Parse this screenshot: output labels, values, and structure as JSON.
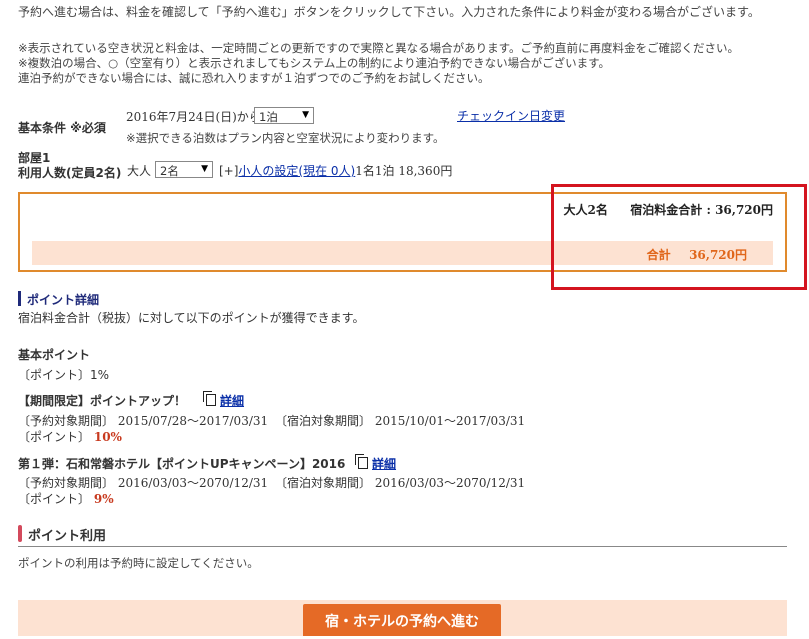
{
  "intro": {
    "line1": "予約へ進む場合は、料金を確認して「予約へ進む」ボタンをクリックして下さい。入力された条件により料金が変わる場合がございます。",
    "note1": "※表示されている空き状況と料金は、一定時間ごとの更新ですので実際と異なる場合があります。ご予約直前に再度料金をご確認ください。",
    "note2": "※複数泊の場合、○（空室有り）と表示されましてもシステム上の制約により連泊予約できない場合がございます。",
    "note3": "連泊予約ができない場合には、誠に恐れ入りますが１泊ずつでのご予約をお試しください。"
  },
  "conditions": {
    "label": "基本条件 ※必須",
    "checkin_date": "2016年7月24日(日)から",
    "nights_selected": "1泊",
    "change_checkin_link": "チェックイン日変更",
    "nights_note": "※選択できる泊数はプラン内容と空室状況により変わります。",
    "room_label": "部屋1",
    "guests_label": "利用人数(定員2名)",
    "adult_label": "大人",
    "adults_selected": "2名",
    "child_prefix": "[+]",
    "child_link": "小人の設定(現在 0人)",
    "per_person_price": "1名1泊 18,360円"
  },
  "price_summary": {
    "guests": "大人2名",
    "subtotal_label": "宿泊料金合計 : 36,720円",
    "total_label": "合計",
    "total_value": "36,720円"
  },
  "points": {
    "heading": "ポイント詳細",
    "description": "宿泊料金合計（税抜）に対して以下のポイントが獲得できます。",
    "basic": {
      "title": "基本ポイント",
      "rate": "〔ポイント〕1%"
    },
    "limited": {
      "title": "【期間限定】ポイントアップ！",
      "detail_link": "詳細",
      "reserve_period": "〔予約対象期間〕 2015/07/28〜2017/03/31",
      "stay_period": "〔宿泊対象期間〕 2015/10/01〜2017/03/31",
      "point_label": "〔ポイント〕",
      "point_value": "10%"
    },
    "campaign": {
      "title": "第１弾：石和常磐ホテル【ポイントUPキャンペーン】2016",
      "detail_link": "詳細",
      "reserve_period": "〔予約対象期間〕 2016/03/03〜2070/12/31",
      "stay_period": "〔宿泊対象期間〕 2016/03/03〜2070/12/31",
      "point_label": "〔ポイント〕",
      "point_value": "9%"
    }
  },
  "point_usage": {
    "heading": "ポイント利用",
    "note": "ポイントの利用は予約時に設定してください。"
  },
  "actions": {
    "proceed_button": "宿・ホテルの予約へ進む"
  },
  "colors": {
    "accent_orange": "#e56a26",
    "box_border": "#e08a2d",
    "highlight_red": "#d4141f",
    "total_bar": "#fde2d2",
    "link_blue": "#0a2fa8"
  }
}
